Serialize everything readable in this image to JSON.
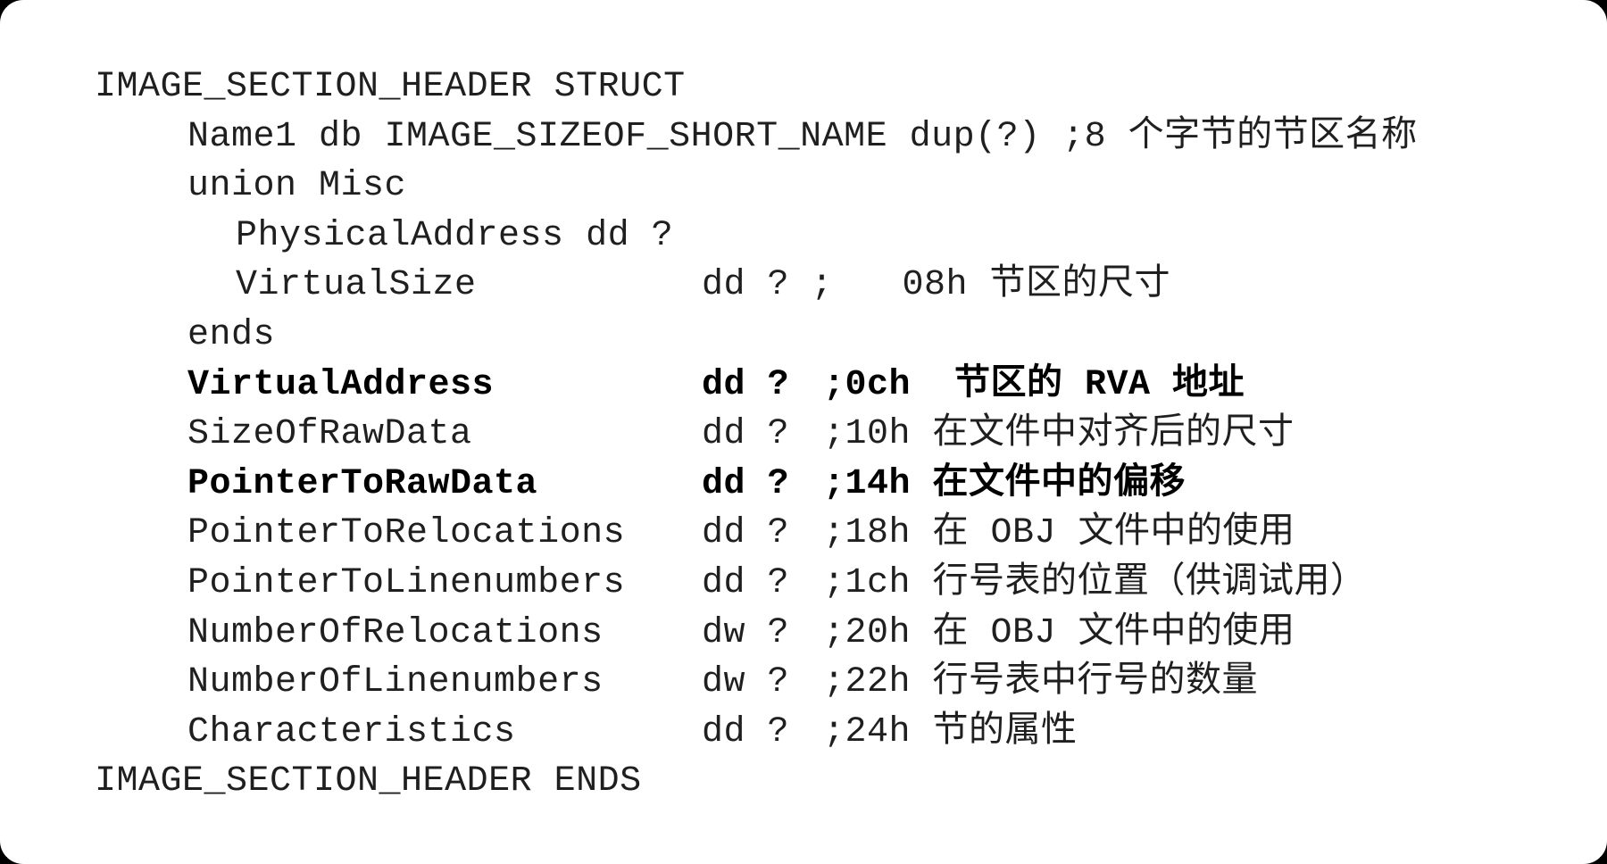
{
  "code": {
    "header": "IMAGE_SECTION_HEADER STRUCT",
    "name1": {
      "text": "Name1 db IMAGE_SIZEOF_SHORT_NAME dup(?) ;8 个字节的节区名称"
    },
    "union_open": "union Misc",
    "physical_address": "PhysicalAddress dd ?",
    "virtual_size": {
      "name": "VirtualSize",
      "type": "dd ? ;",
      "comment": " 08h 节区的尺寸"
    },
    "union_close": "ends",
    "fields": [
      {
        "name": "VirtualAddress",
        "type": "dd ?",
        "comment": ";0ch  节区的 RVA 地址",
        "bold": true
      },
      {
        "name": "SizeOfRawData",
        "type": "dd ?",
        "comment": ";10h 在文件中对齐后的尺寸",
        "bold": false
      },
      {
        "name": "PointerToRawData",
        "type": "dd ?",
        "comment": ";14h 在文件中的偏移",
        "bold": true
      },
      {
        "name": "PointerToRelocations",
        "type": "dd ?",
        "comment": ";18h 在 OBJ 文件中的使用",
        "bold": false
      },
      {
        "name": "PointerToLinenumbers",
        "type": "dd ?",
        "comment": ";1ch 行号表的位置（供调试用）",
        "bold": false
      },
      {
        "name": "NumberOfRelocations",
        "type": "dw ?",
        "comment": ";20h 在 OBJ 文件中的使用",
        "bold": false
      },
      {
        "name": "NumberOfLinenumbers",
        "type": "dw ?",
        "comment": ";22h 行号表中行号的数量",
        "bold": false
      },
      {
        "name": "Characteristics",
        "type": "dd ?",
        "comment": ";24h 节的属性",
        "bold": false
      }
    ],
    "footer": "IMAGE_SECTION_HEADER ENDS"
  }
}
